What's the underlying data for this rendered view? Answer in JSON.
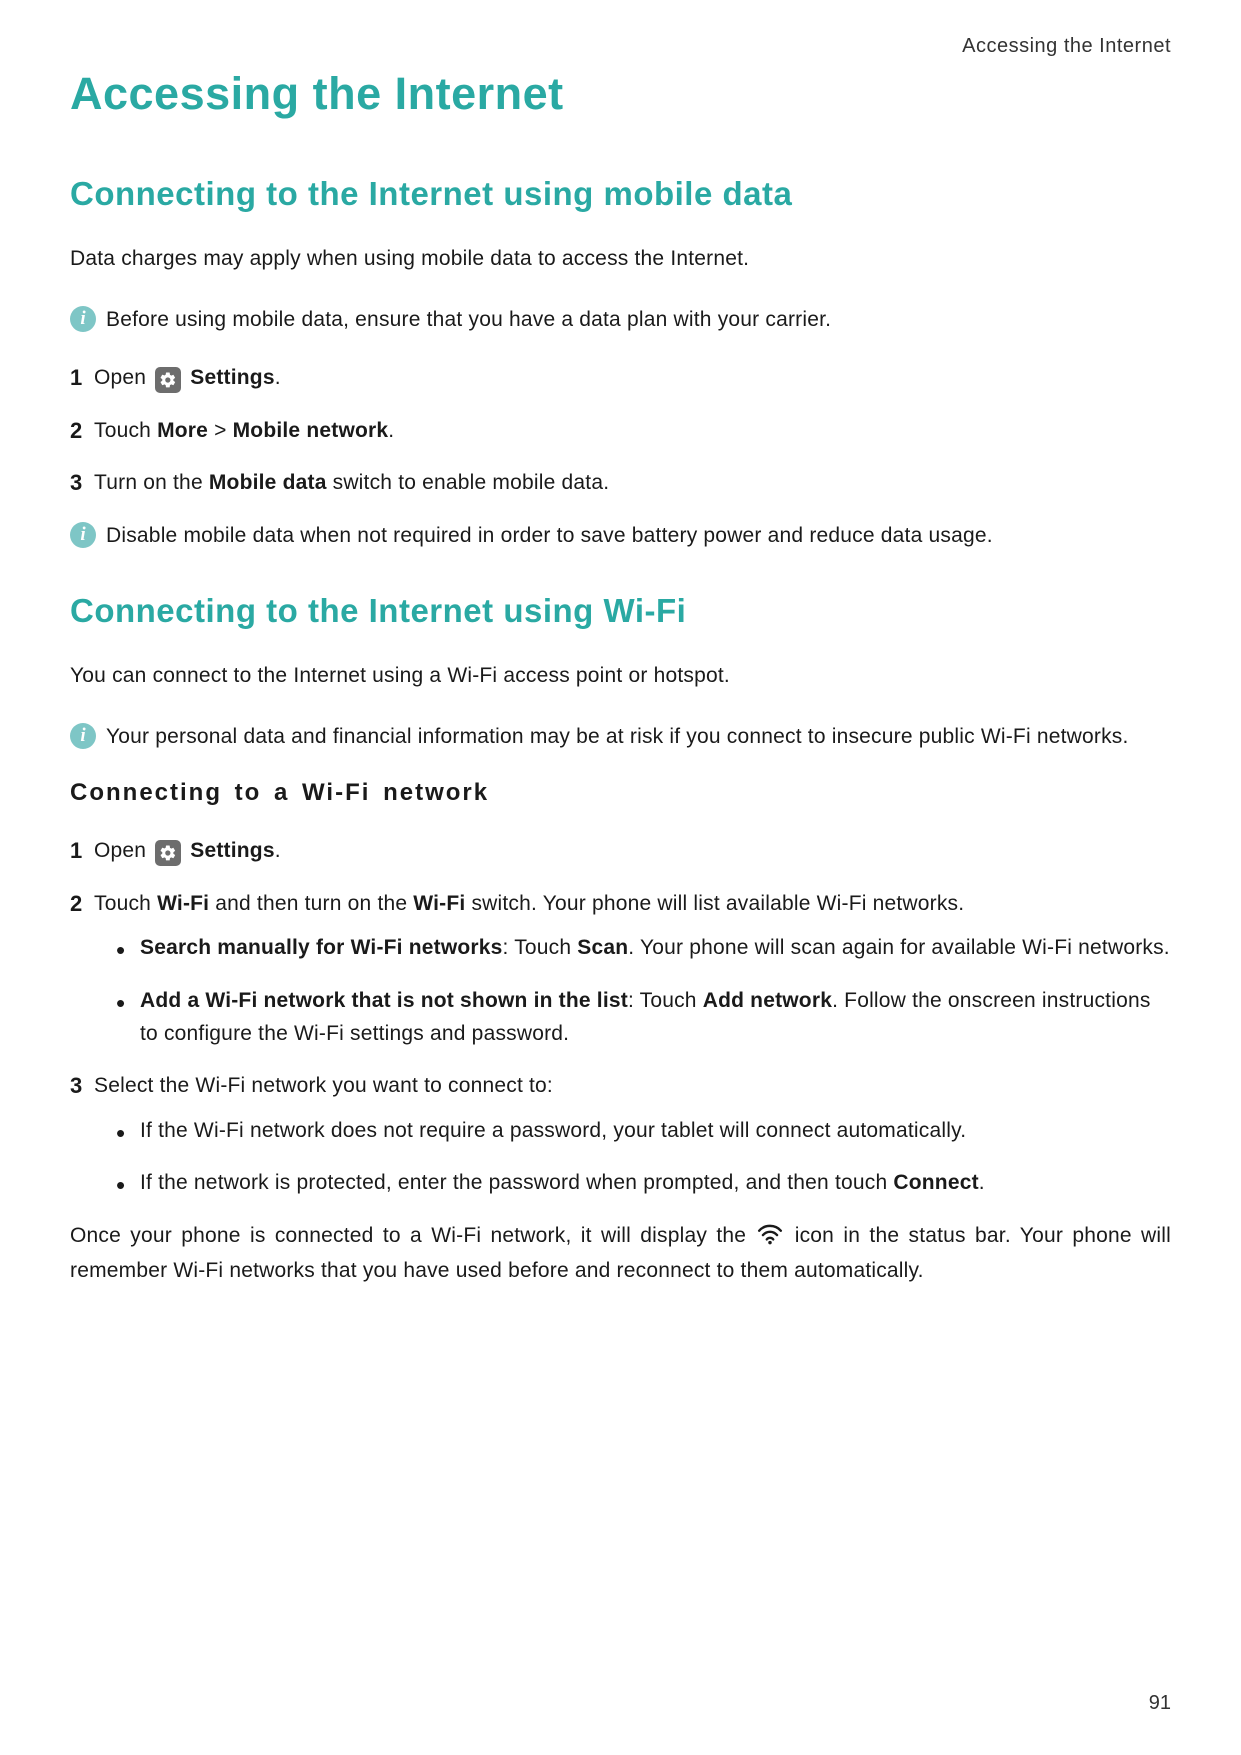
{
  "running_head": "Accessing the Internet",
  "title": "Accessing the Internet",
  "page_number": "91",
  "section1": {
    "heading": "Connecting to the Internet using mobile data",
    "intro": "Data charges may apply when using mobile data to access the Internet.",
    "info1": "Before using mobile data, ensure that you have a data plan with your carrier.",
    "step1_a": "Open ",
    "step1_b": "Settings",
    "step1_c": ".",
    "step2_a": "Touch ",
    "step2_b": "More",
    "step2_c": " > ",
    "step2_d": "Mobile network",
    "step2_e": ".",
    "step3_a": "Turn on the ",
    "step3_b": "Mobile data",
    "step3_c": " switch to enable mobile data.",
    "info2": "Disable mobile data when not required in order to save battery power and reduce data usage."
  },
  "section2": {
    "heading": "Connecting to the Internet using Wi-Fi",
    "intro": "You can connect to the Internet using a Wi-Fi access point or hotspot.",
    "info1": "Your personal data and financial information may be at risk if you connect to insecure public Wi-Fi networks.",
    "subhead": "Connecting to a Wi-Fi network",
    "step1_a": "Open ",
    "step1_b": "Settings",
    "step1_c": ".",
    "step2_a": "Touch ",
    "step2_b": "Wi-Fi",
    "step2_c": " and then turn on the ",
    "step2_d": "Wi-Fi",
    "step2_e": " switch. Your phone will list available Wi-Fi networks.",
    "bullet1_a": "Search manually for Wi-Fi networks",
    "bullet1_b": ": Touch ",
    "bullet1_c": "Scan",
    "bullet1_d": ". Your phone will scan again for available Wi-Fi networks.",
    "bullet2_a": "Add a Wi-Fi network that is not shown in the list",
    "bullet2_b": ": Touch ",
    "bullet2_c": "Add network",
    "bullet2_d": ". Follow the onscreen instructions to configure the Wi-Fi settings and password.",
    "step3": "Select the Wi-Fi network you want to connect to:",
    "bullet3": "If the Wi-Fi network does not require a password, your tablet will connect automatically.",
    "bullet4_a": "If the network is protected, enter the password when prompted, and then touch ",
    "bullet4_b": "Connect",
    "bullet4_c": ".",
    "outro_a": "Once your phone is connected to a Wi-Fi network, it will display the ",
    "outro_b": " icon in the status bar. Your phone will remember Wi-Fi networks that you have used before and reconnect to them automatically."
  }
}
